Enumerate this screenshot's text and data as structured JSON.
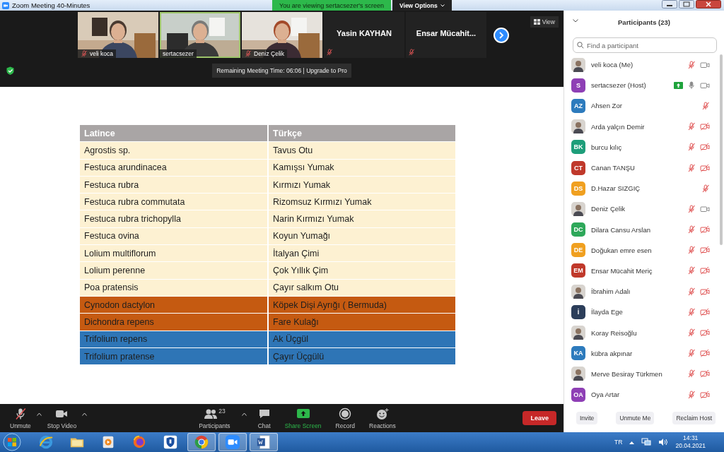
{
  "window": {
    "title": "Zoom Meeting 40-Minutes",
    "banner": "You are viewing sertacsezer's screen",
    "view_options": "View Options"
  },
  "videos": [
    {
      "kind": "picture",
      "name": "veli koca",
      "muted": true,
      "active": false
    },
    {
      "kind": "picture",
      "name": "sertacsezer",
      "muted": false,
      "active": true
    },
    {
      "kind": "picture",
      "name": "Deniz Çelik",
      "muted": true,
      "active": false
    },
    {
      "kind": "name",
      "name": "Yasin KAYHAN",
      "muted": true,
      "active": false
    },
    {
      "kind": "name",
      "name": "Ensar  Mücahit...",
      "muted": true,
      "active": false
    }
  ],
  "view_button": "View",
  "remaining_time": "Remaining Meeting Time: 06:06 | Upgrade to Pro",
  "shared_table": {
    "columns": [
      "Latince",
      "Türkçe"
    ],
    "rows": [
      {
        "cells": [
          "Agrostis sp.",
          "Tavus Otu"
        ],
        "color": "#fdf1d2"
      },
      {
        "cells": [
          "Festuca arundinacea",
          "Kamışsı Yumak"
        ],
        "color": "#fdf1d2"
      },
      {
        "cells": [
          "Festuca rubra",
          "Kırmızı Yumak"
        ],
        "color": "#fdf1d2"
      },
      {
        "cells": [
          "Festuca rubra commutata",
          "Rizomsuz Kırmızı Yumak"
        ],
        "color": "#fdf1d2"
      },
      {
        "cells": [
          "Festuca rubra trichopylla",
          "Narin Kırmızı Yumak"
        ],
        "color": "#fdf1d2"
      },
      {
        "cells": [
          "Festuca ovina",
          "Koyun Yumağı"
        ],
        "color": "#fdf1d2"
      },
      {
        "cells": [
          "Lolium multiflorum",
          "İtalyan Çimi"
        ],
        "color": "#fdf1d2"
      },
      {
        "cells": [
          "Lolium perenne",
          "Çok Yıllık Çim"
        ],
        "color": "#fdf1d2"
      },
      {
        "cells": [
          "Poa pratensis",
          "Çayır salkım Otu"
        ],
        "color": "#fdf1d2"
      },
      {
        "cells": [
          "Cynodon dactylon",
          "Köpek Dişi Ayrığı ( Bermuda)"
        ],
        "color": "#c55a11"
      },
      {
        "cells": [
          "Dichondra repens",
          "Fare Kulağı"
        ],
        "color": "#c55a11"
      },
      {
        "cells": [
          "Trifolium repens",
          "Ak Üçgül"
        ],
        "color": "#2e75b6"
      },
      {
        "cells": [
          "Trifolium pratense",
          "Çayır Üçgülü"
        ],
        "color": "#2e75b6"
      }
    ]
  },
  "toolbar": {
    "items": [
      {
        "kind": "mic",
        "label": "Unmute",
        "muted": true,
        "menu": true
      },
      {
        "kind": "video",
        "label": "Stop Video",
        "menu": true
      },
      {
        "kind": "participants",
        "label": "Participants",
        "count": "23",
        "menu": true
      },
      {
        "kind": "chat",
        "label": "Chat",
        "menu": false
      },
      {
        "kind": "share",
        "label": "Share Screen",
        "menu": false
      },
      {
        "kind": "record",
        "label": "Record",
        "menu": false
      },
      {
        "kind": "reactions",
        "label": "Reactions",
        "menu": false
      }
    ],
    "leave": "Leave"
  },
  "participants_panel": {
    "title": "Participants (23)",
    "search": {
      "placeholder": "Find a participant"
    },
    "participants": [
      {
        "name": "veli koca (Me)",
        "sharing": false,
        "mic": {
          "muted": true
        },
        "video": {
          "off": false
        }
      },
      {
        "name": "sertacsezer (Host)",
        "avatar": {
          "kind": "initials",
          "text": "S",
          "color": "#8e3fb5"
        },
        "sharing": true,
        "mic": {
          "muted": false
        },
        "video": {
          "off": false
        }
      },
      {
        "name": "Ahsen Zor",
        "avatar": {
          "kind": "initials",
          "text": "AZ",
          "color": "#2d7bbd"
        },
        "sharing": false,
        "mic": {
          "muted": true
        }
      },
      {
        "name": "Arda yalçın Demir",
        "sharing": false,
        "mic": {
          "muted": true
        },
        "video": {
          "off": true
        }
      },
      {
        "name": "burcu kılıç",
        "avatar": {
          "kind": "initials",
          "text": "BK",
          "color": "#1e9e7a"
        },
        "sharing": false,
        "mic": {
          "muted": true
        },
        "video": {
          "off": true
        }
      },
      {
        "name": "Canan TANŞU",
        "avatar": {
          "kind": "initials",
          "text": "CT",
          "color": "#c0392b"
        },
        "sharing": false,
        "mic": {
          "muted": true
        },
        "video": {
          "off": true
        }
      },
      {
        "name": "D.Hazar SIZGIÇ",
        "avatar": {
          "kind": "initials",
          "text": "DS",
          "color": "#f0a020"
        },
        "sharing": false,
        "mic": {
          "muted": true
        }
      },
      {
        "name": "Deniz Çelik",
        "sharing": false,
        "mic": {
          "muted": true
        },
        "video": {
          "off": false
        }
      },
      {
        "name": "Dilara Cansu Arslan",
        "avatar": {
          "kind": "initials",
          "text": "DC",
          "color": "#2ea85a"
        },
        "sharing": false,
        "mic": {
          "muted": true
        },
        "video": {
          "off": true
        }
      },
      {
        "name": "Doğukan emre esen",
        "avatar": {
          "kind": "initials",
          "text": "DE",
          "color": "#f0a020"
        },
        "sharing": false,
        "mic": {
          "muted": true
        },
        "video": {
          "off": true
        }
      },
      {
        "name": "Ensar Mücahit Meriç",
        "avatar": {
          "kind": "initials",
          "text": "EM",
          "color": "#c0392b"
        },
        "sharing": false,
        "mic": {
          "muted": true
        },
        "video": {
          "off": true
        }
      },
      {
        "name": "İbrahim Adalı",
        "sharing": false,
        "mic": {
          "muted": true
        },
        "video": {
          "off": true
        }
      },
      {
        "name": "İlayda Ege",
        "avatar": {
          "kind": "initials",
          "text": "İ",
          "color": "#2c3e5a"
        },
        "sharing": false,
        "mic": {
          "muted": true
        },
        "video": {
          "off": true
        }
      },
      {
        "name": "Koray Reisoğlu",
        "sharing": false,
        "mic": {
          "muted": true
        },
        "video": {
          "off": true
        }
      },
      {
        "name": "kübra akpınar",
        "avatar": {
          "kind": "initials",
          "text": "KA",
          "color": "#2d7bbd"
        },
        "sharing": false,
        "mic": {
          "muted": true
        },
        "video": {
          "off": true
        }
      },
      {
        "name": "Merve Besiray Türkmen",
        "sharing": false,
        "mic": {
          "muted": true
        },
        "video": {
          "off": true
        }
      },
      {
        "name": "Oya Artar",
        "avatar": {
          "kind": "initials",
          "text": "OA",
          "color": "#8e3fb5"
        },
        "sharing": false,
        "mic": {
          "muted": true
        },
        "video": {
          "off": true
        }
      }
    ],
    "buttons": [
      "Invite",
      "Unmute Me",
      "Reclaim Host"
    ]
  },
  "taskbar": {
    "apps": [
      {
        "kind": "browser-e",
        "active": false
      },
      {
        "kind": "folder",
        "active": false
      },
      {
        "kind": "player",
        "active": false
      },
      {
        "kind": "fox",
        "active": false
      },
      {
        "kind": "shield",
        "active": false
      },
      {
        "kind": "chrome",
        "active": true
      },
      {
        "kind": "camera",
        "active": true
      },
      {
        "kind": "document",
        "active": true
      }
    ],
    "language": "TR",
    "time": "14:31",
    "date": "20.04.2021"
  }
}
